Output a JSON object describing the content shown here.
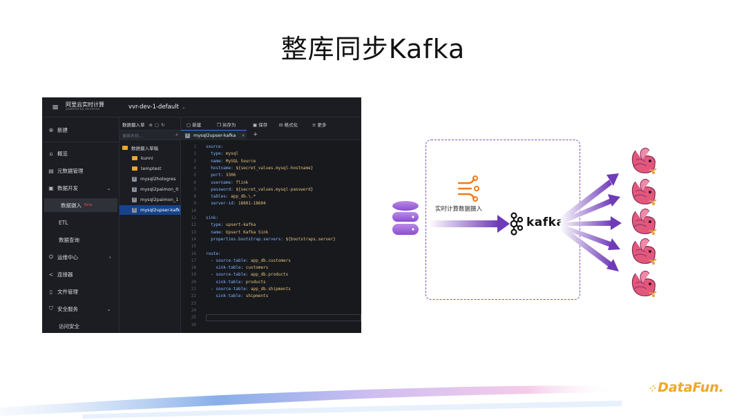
{
  "slide": {
    "title": "整库同步Kafka"
  },
  "app": {
    "brand_name": "阿里云实时计算",
    "brand_sub": "powered by ververica",
    "workspace": "vvr-dev-1-default",
    "nav": {
      "new": "新建",
      "overview": "概览",
      "metadata": "元数据管理",
      "dev": "数据开发",
      "ingest": "数据摄入",
      "beta": "Beta",
      "etl": "ETL",
      "query": "数据查询",
      "ops": "运维中心",
      "connectors": "连接器",
      "files": "文件管理",
      "security": "安全服务",
      "access": "访问安全"
    },
    "tree": {
      "header": "数据摄入草",
      "search_placeholder": "搜索名称...",
      "items": [
        {
          "label": "数据摄入草稿",
          "type": "folder"
        },
        {
          "label": "kunni",
          "type": "folder"
        },
        {
          "label": "temptest",
          "type": "folder"
        },
        {
          "label": "mysql2hologres",
          "type": "file"
        },
        {
          "label": "mysql2paimon_0",
          "type": "file"
        },
        {
          "label": "mysql2paimon_1",
          "type": "file"
        },
        {
          "label": "mysql2upser-kafk",
          "type": "file"
        }
      ]
    },
    "toolbar": {
      "new": "新建",
      "save_as": "另存为",
      "save": "保存",
      "format": "格式化",
      "more": "更多"
    },
    "tab": {
      "label": "mysql2upser-kafka"
    },
    "code_lines": [
      {
        "n": "1",
        "t": "source:"
      },
      {
        "n": "2",
        "t": "  type: mysql"
      },
      {
        "n": "3",
        "t": "  name: MySQL Source"
      },
      {
        "n": "4",
        "t": "  hostname: ${secret_values.mysql-hostname}"
      },
      {
        "n": "5",
        "t": "  port: 3306"
      },
      {
        "n": "6",
        "t": "  username: flink"
      },
      {
        "n": "7",
        "t": "  password: ${secret_values.mysql-password}"
      },
      {
        "n": "8",
        "t": "  tables: app_db.\\.*"
      },
      {
        "n": "9",
        "t": "  server-id: 18601-18604"
      },
      {
        "n": "10",
        "t": ""
      },
      {
        "n": "11",
        "t": "sink:"
      },
      {
        "n": "12",
        "t": "  type: upsert-kafka"
      },
      {
        "n": "13",
        "t": "  name: Upsert Kafka Sink"
      },
      {
        "n": "14",
        "t": "  properties.bootstrap.servers: ${bootstraps.server}"
      },
      {
        "n": "15",
        "t": ""
      },
      {
        "n": "16",
        "t": "route:"
      },
      {
        "n": "17",
        "t": "  - source-table: app_db.customers"
      },
      {
        "n": "18",
        "t": "    sink-table: customers"
      },
      {
        "n": "19",
        "t": "  - source-table: app_db.products"
      },
      {
        "n": "20",
        "t": "    sink-table: products"
      },
      {
        "n": "21",
        "t": "  - source-table: app_db.shipments"
      },
      {
        "n": "22",
        "t": "    sink-table: shipments"
      },
      {
        "n": "23",
        "t": ""
      },
      {
        "n": "24",
        "t": ""
      },
      {
        "n": "25",
        "t": ""
      },
      {
        "n": "26",
        "t": ""
      }
    ]
  },
  "diagram": {
    "ingest_label": "实时计算数据摄入",
    "kafka_label": "kafka"
  },
  "footer": {
    "logo": "DataFun."
  },
  "colors": {
    "accent": "#7b4bbb",
    "ingest": "#f07a1a",
    "brand": "#f0a62a"
  }
}
